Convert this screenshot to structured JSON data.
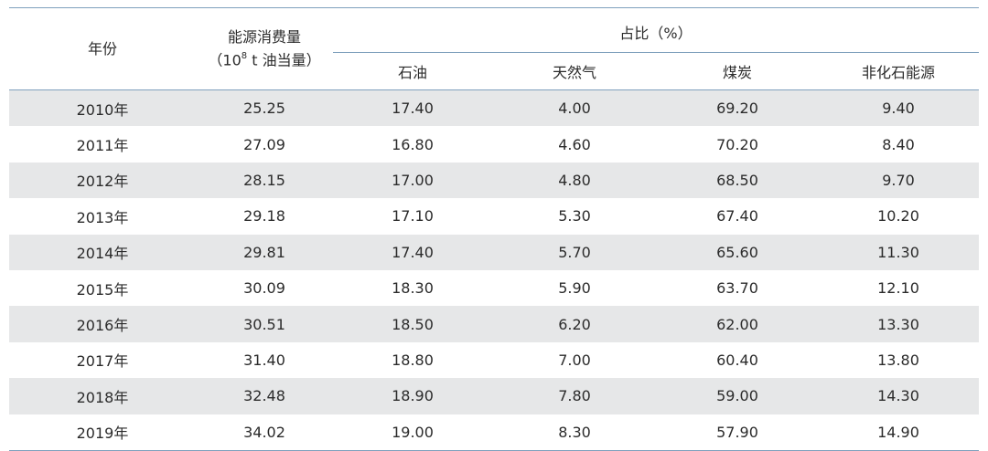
{
  "table": {
    "headers": {
      "year": "年份",
      "consumption_line1": "能源消费量",
      "consumption_line2_prefix": "（10",
      "consumption_line2_exp": "8",
      "consumption_line2_suffix": " t 油当量）",
      "share": "占比（%）",
      "oil": "石油",
      "gas": "天然气",
      "coal": "煤炭",
      "non_fossil": "非化石能源"
    },
    "rows": [
      {
        "year": "2010年",
        "consumption": "25.25",
        "oil": "17.40",
        "gas": "4.00",
        "coal": "69.20",
        "non_fossil": "9.40"
      },
      {
        "year": "2011年",
        "consumption": "27.09",
        "oil": "16.80",
        "gas": "4.60",
        "coal": "70.20",
        "non_fossil": "8.40"
      },
      {
        "year": "2012年",
        "consumption": "28.15",
        "oil": "17.00",
        "gas": "4.80",
        "coal": "68.50",
        "non_fossil": "9.70"
      },
      {
        "year": "2013年",
        "consumption": "29.18",
        "oil": "17.10",
        "gas": "5.30",
        "coal": "67.40",
        "non_fossil": "10.20"
      },
      {
        "year": "2014年",
        "consumption": "29.81",
        "oil": "17.40",
        "gas": "5.70",
        "coal": "65.60",
        "non_fossil": "11.30"
      },
      {
        "year": "2015年",
        "consumption": "30.09",
        "oil": "18.30",
        "gas": "5.90",
        "coal": "63.70",
        "non_fossil": "12.10"
      },
      {
        "year": "2016年",
        "consumption": "30.51",
        "oil": "18.50",
        "gas": "6.20",
        "coal": "62.00",
        "non_fossil": "13.30"
      },
      {
        "year": "2017年",
        "consumption": "31.40",
        "oil": "18.80",
        "gas": "7.00",
        "coal": "60.40",
        "non_fossil": "13.80"
      },
      {
        "year": "2018年",
        "consumption": "32.48",
        "oil": "18.90",
        "gas": "7.80",
        "coal": "59.00",
        "non_fossil": "14.30"
      },
      {
        "year": "2019年",
        "consumption": "34.02",
        "oil": "19.00",
        "gas": "8.30",
        "coal": "57.90",
        "non_fossil": "14.90"
      }
    ]
  }
}
